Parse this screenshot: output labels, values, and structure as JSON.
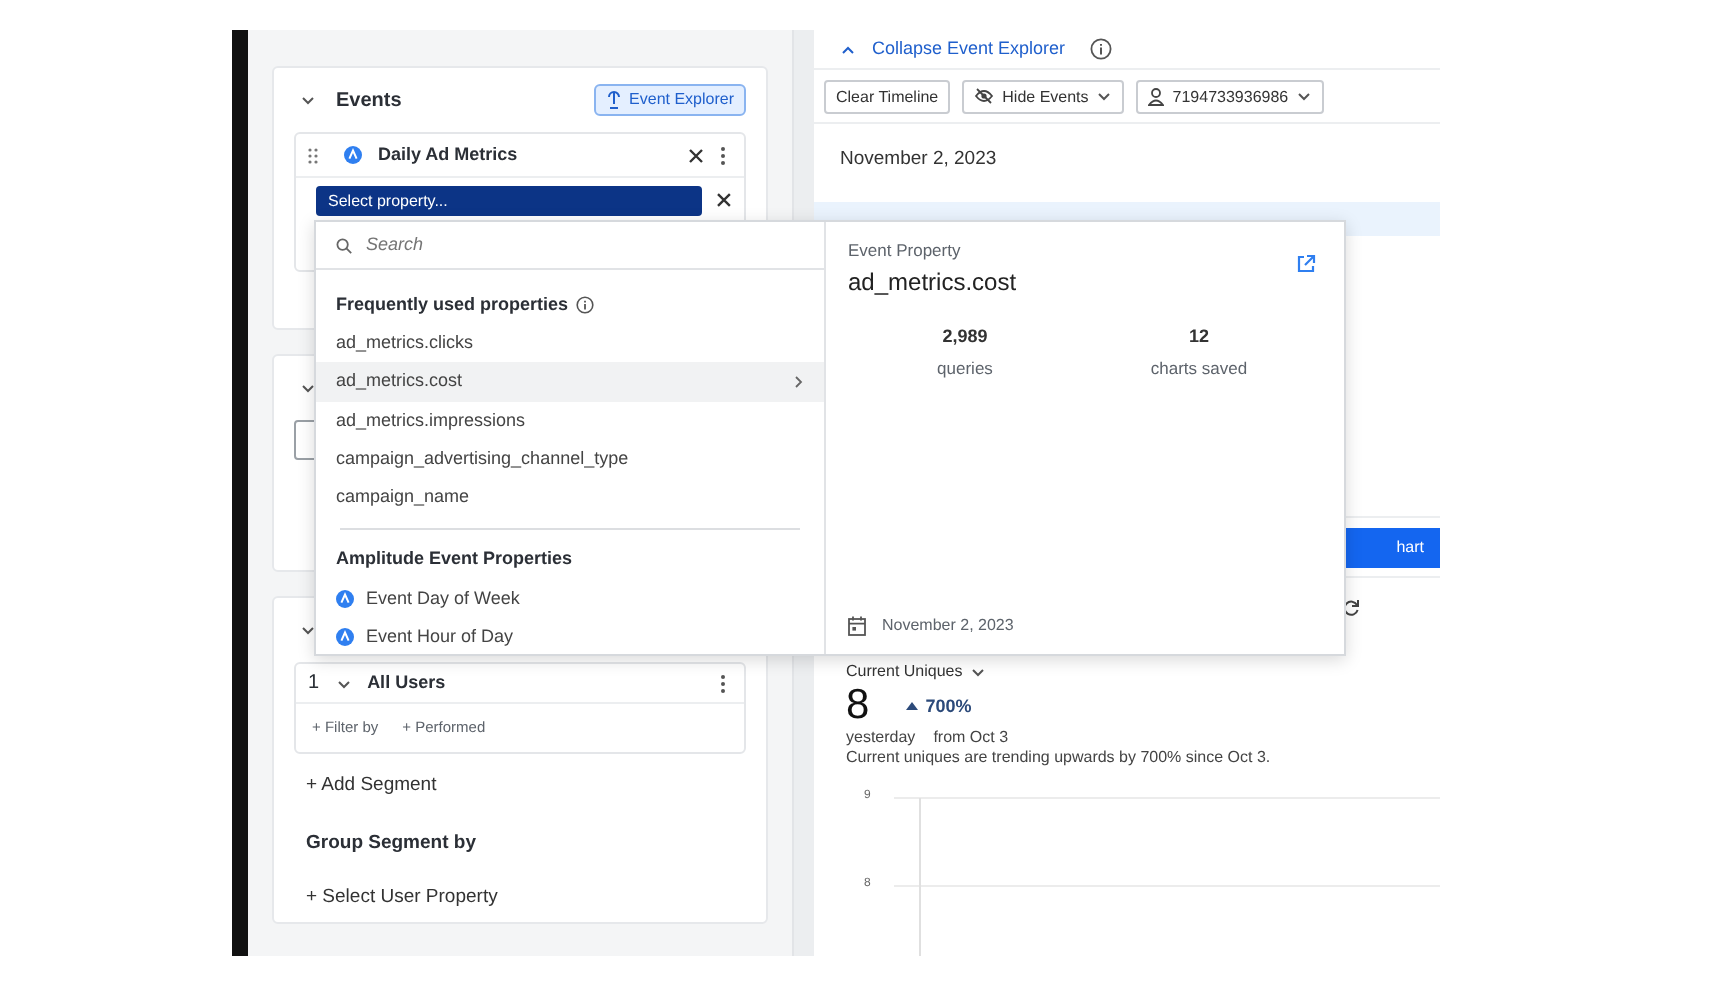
{
  "events_panel": {
    "title": "Events",
    "explorer_button": "Event Explorer",
    "event": {
      "name": "Daily Ad Metrics"
    },
    "property_select": {
      "value": "Select property..."
    }
  },
  "segments_panel": {
    "segments": [
      {
        "index": "1",
        "name": "All Users",
        "actions": [
          "+ Filter by",
          "+ Performed"
        ]
      }
    ],
    "add_segment": "+ Add Segment",
    "group_title": "Group Segment by",
    "group_action": "+ Select User Property"
  },
  "explorer": {
    "collapse": "Collapse Event Explorer",
    "toolbar": [
      {
        "label": "Clear Timeline",
        "kind": "plain"
      },
      {
        "label": "Hide Events",
        "kind": "hide"
      },
      {
        "label": "7194733936986",
        "kind": "user"
      }
    ],
    "date": "November 2, 2023",
    "chart_button": "hart",
    "metric": {
      "selector": "Current Uniques",
      "value": "8",
      "change": "700%",
      "value_caption": "yesterday",
      "change_caption": "from Oct 3",
      "summary": "Current uniques are trending upwards by 700% since Oct 3."
    },
    "chart": {
      "y_ticks": [
        "9",
        "8"
      ]
    }
  },
  "property_picker": {
    "search": {
      "placeholder": "Search"
    },
    "groups": [
      {
        "title": "Frequently used properties",
        "kind": "custom",
        "items": [
          {
            "label": "ad_metrics.clicks",
            "selected": false
          },
          {
            "label": "ad_metrics.cost",
            "selected": true
          },
          {
            "label": "ad_metrics.impressions",
            "selected": false
          },
          {
            "label": "campaign_advertising_channel_type",
            "selected": false
          },
          {
            "label": "campaign_name",
            "selected": false
          }
        ]
      },
      {
        "title": "Amplitude Event Properties",
        "kind": "amplitude",
        "items": [
          {
            "label": "Event Day of Week",
            "selected": false
          },
          {
            "label": "Event Hour of Day",
            "selected": false
          }
        ]
      }
    ]
  },
  "property_detail": {
    "type": "Event Property",
    "name": "ad_metrics.cost",
    "stats": [
      {
        "value": "2,989",
        "label": "queries"
      },
      {
        "value": "12",
        "label": "charts saved"
      }
    ],
    "date": "November 2, 2023"
  }
}
